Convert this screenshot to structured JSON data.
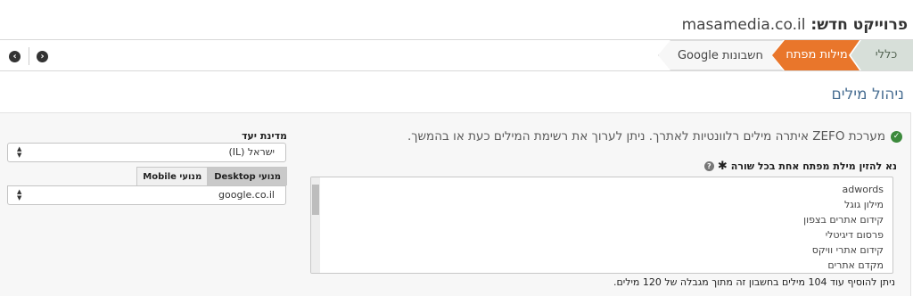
{
  "header": {
    "title_prefix": "פרוייקט חדש:",
    "domain": "masamedia.co.il"
  },
  "wizard": {
    "steps": [
      {
        "label": "כללי",
        "state": "done"
      },
      {
        "label": "מילות מפתח",
        "state": "active"
      },
      {
        "label": "חשבונות Google",
        "state": "upcoming"
      }
    ],
    "back_icon": "arrow-left-circle-icon",
    "forward_icon": "arrow-right-circle-icon",
    "accent_color": "#e9762b"
  },
  "section": {
    "title": "ניהול מילים"
  },
  "message": {
    "success": "מערכת ZEFO איתרה מילים רלוונטיות לאתרך. ניתן לערוך את רשימת המילים כעת או בהמשך.",
    "icon": "check-circle-icon"
  },
  "keywords": {
    "instruction": "נא להזין מילת מפתח אחת בכל שורה",
    "lines": [
      "adwords",
      "מילון גוגל",
      "קידום אתרים בצפון",
      "פרסום דיגיטלי",
      "קידום אתרי וויקס",
      "מקדם אתרים"
    ],
    "limit_note": "ניתן להוסיף עוד 104 מילים בחשבון זה מתוך מגבלה של 120 מילים."
  },
  "settings": {
    "country_label": "מדינת יעד",
    "country_value": "ישראל (IL)",
    "tabs": [
      {
        "label": "מנועי Desktop",
        "selected": true
      },
      {
        "label": "מנועי Mobile",
        "selected": false
      }
    ],
    "search_engine_value": "google.co.il"
  }
}
